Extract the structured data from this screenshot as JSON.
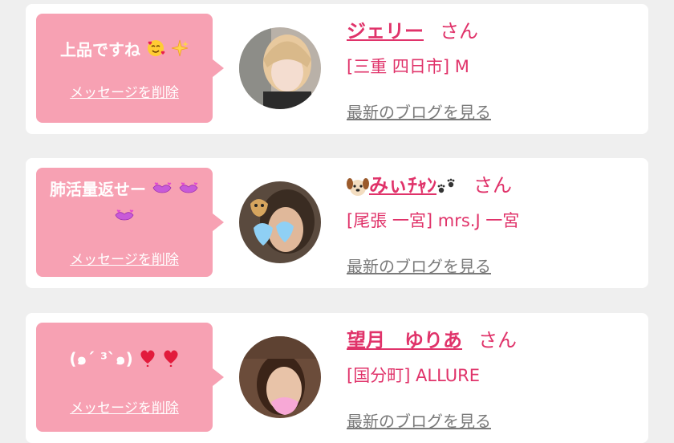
{
  "colors": {
    "accent": "#e0336a",
    "bubble": "#f7a1b3",
    "link_gray": "#7a7a7a",
    "background": "#efefef"
  },
  "cards": [
    {
      "message_lines": [
        "上品ですね"
      ],
      "message_emojis": [
        "smiling-face-with-hearts-icon",
        "sparkles-icon"
      ],
      "delete_label": "メッセージを削除",
      "name": "ジェリー",
      "honorific": "さん",
      "area": "[三重 四日市] M",
      "blog_link": "最新のブログを見る"
    },
    {
      "message_lines": [
        "肺活量返せー"
      ],
      "message_emojis": [
        "heart-lips-icon",
        "heart-lips-icon",
        "heart-lips-icon"
      ],
      "delete_label": "メッセージを削除",
      "name": "みぃﾁｬﾝ",
      "name_emojis": [
        "dog-face-icon",
        "paw-prints-icon"
      ],
      "honorific": "さん",
      "area": "[尾張 一宮] mrs.J 一宮",
      "blog_link": "最新のブログを見る"
    },
    {
      "message_lines": [
        "(๑´ ³`๑)"
      ],
      "message_emojis": [
        "heart-exclamation-icon",
        "heart-exclamation-icon"
      ],
      "delete_label": "メッセージを削除",
      "name": "望月　ゆりあ",
      "honorific": "さん",
      "area": "[国分町] ALLURE",
      "blog_link": "最新のブログを見る"
    }
  ]
}
